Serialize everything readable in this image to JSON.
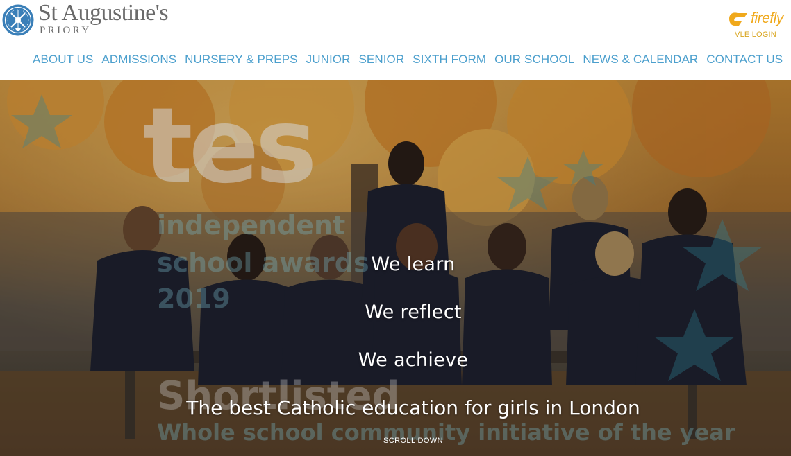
{
  "logo": {
    "name": "St Augustine's",
    "sub": "PRIORY"
  },
  "firefly": {
    "brand": "firefly",
    "login": "VLE LOGIN",
    "icon": "firefly-logo-icon",
    "color": "#f0a91c"
  },
  "nav": [
    "ABOUT US",
    "ADMISSIONS",
    "NURSERY & PREPS",
    "JUNIOR",
    "SENIOR",
    "SIXTH FORM",
    "OUR SCHOOL",
    "NEWS & CALENDAR",
    "CONTACT US"
  ],
  "hero": {
    "taglines": [
      "We learn",
      "We reflect",
      "We achieve"
    ],
    "motto": "The best Catholic education for girls in London",
    "scroll": "SCROLL DOWN",
    "badge": {
      "brand": "tes",
      "line1": "independent",
      "line2": "school awards",
      "line3": "2019",
      "status": "Shortlisted",
      "category": "Whole school community initiative of the year"
    }
  },
  "colors": {
    "nav": "#4b9fcd",
    "logo_text": "#6a6a6a",
    "crest": "#3a7fb8"
  }
}
